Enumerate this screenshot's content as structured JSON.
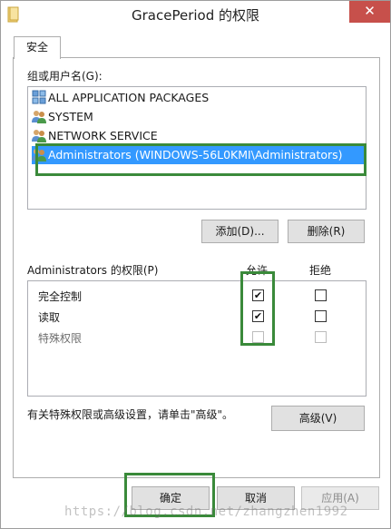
{
  "window": {
    "title": "GracePeriod 的权限",
    "close_label": "✕"
  },
  "tabs": [
    {
      "label": "安全"
    }
  ],
  "groups": {
    "label": "组或用户名(G):",
    "items": [
      {
        "label": "ALL APPLICATION PACKAGES",
        "icon": "application-packages-icon"
      },
      {
        "label": "SYSTEM",
        "icon": "users-group-icon"
      },
      {
        "label": "NETWORK SERVICE",
        "icon": "users-group-icon"
      },
      {
        "label": "Administrators (WINDOWS-56L0KMI\\Administrators)",
        "icon": "users-group-icon",
        "selected": true
      }
    ],
    "add_button": "添加(D)...",
    "remove_button": "删除(R)"
  },
  "permissions": {
    "label": "Administrators 的权限(P)",
    "allow_header": "允许",
    "deny_header": "拒绝",
    "rows": [
      {
        "name": "完全控制",
        "allow": true,
        "deny": false,
        "disabled": false
      },
      {
        "name": "读取",
        "allow": true,
        "deny": false,
        "disabled": false
      },
      {
        "name": "特殊权限",
        "allow": false,
        "deny": false,
        "disabled": true
      }
    ]
  },
  "advanced": {
    "hint": "有关特殊权限或高级设置，请单击\"高级\"。",
    "button": "高级(V)"
  },
  "footer": {
    "ok_button": "确定",
    "cancel_button": "取消",
    "apply_button": "应用(A)"
  },
  "watermark": "https://blog.csdn.net/zhangzhen1992",
  "colors": {
    "selection": "#3399ff",
    "close_button": "#c7504b",
    "highlight_box": "#3a8a3a"
  }
}
